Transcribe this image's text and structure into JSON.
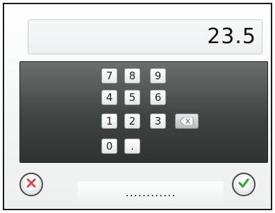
{
  "display": {
    "value": "23.5"
  },
  "keypad": {
    "keys": [
      "7",
      "8",
      "9",
      "4",
      "5",
      "6",
      "1",
      "2",
      "3",
      "0",
      "."
    ],
    "backspace_icon": "backspace-icon"
  },
  "footer": {
    "cancel_icon": "cancel-x-icon",
    "confirm_icon": "confirm-check-icon",
    "dots": "............"
  },
  "colors": {
    "cancel": "#e0443a",
    "confirm": "#2faa2f",
    "panel_dark": "#3f4442"
  }
}
